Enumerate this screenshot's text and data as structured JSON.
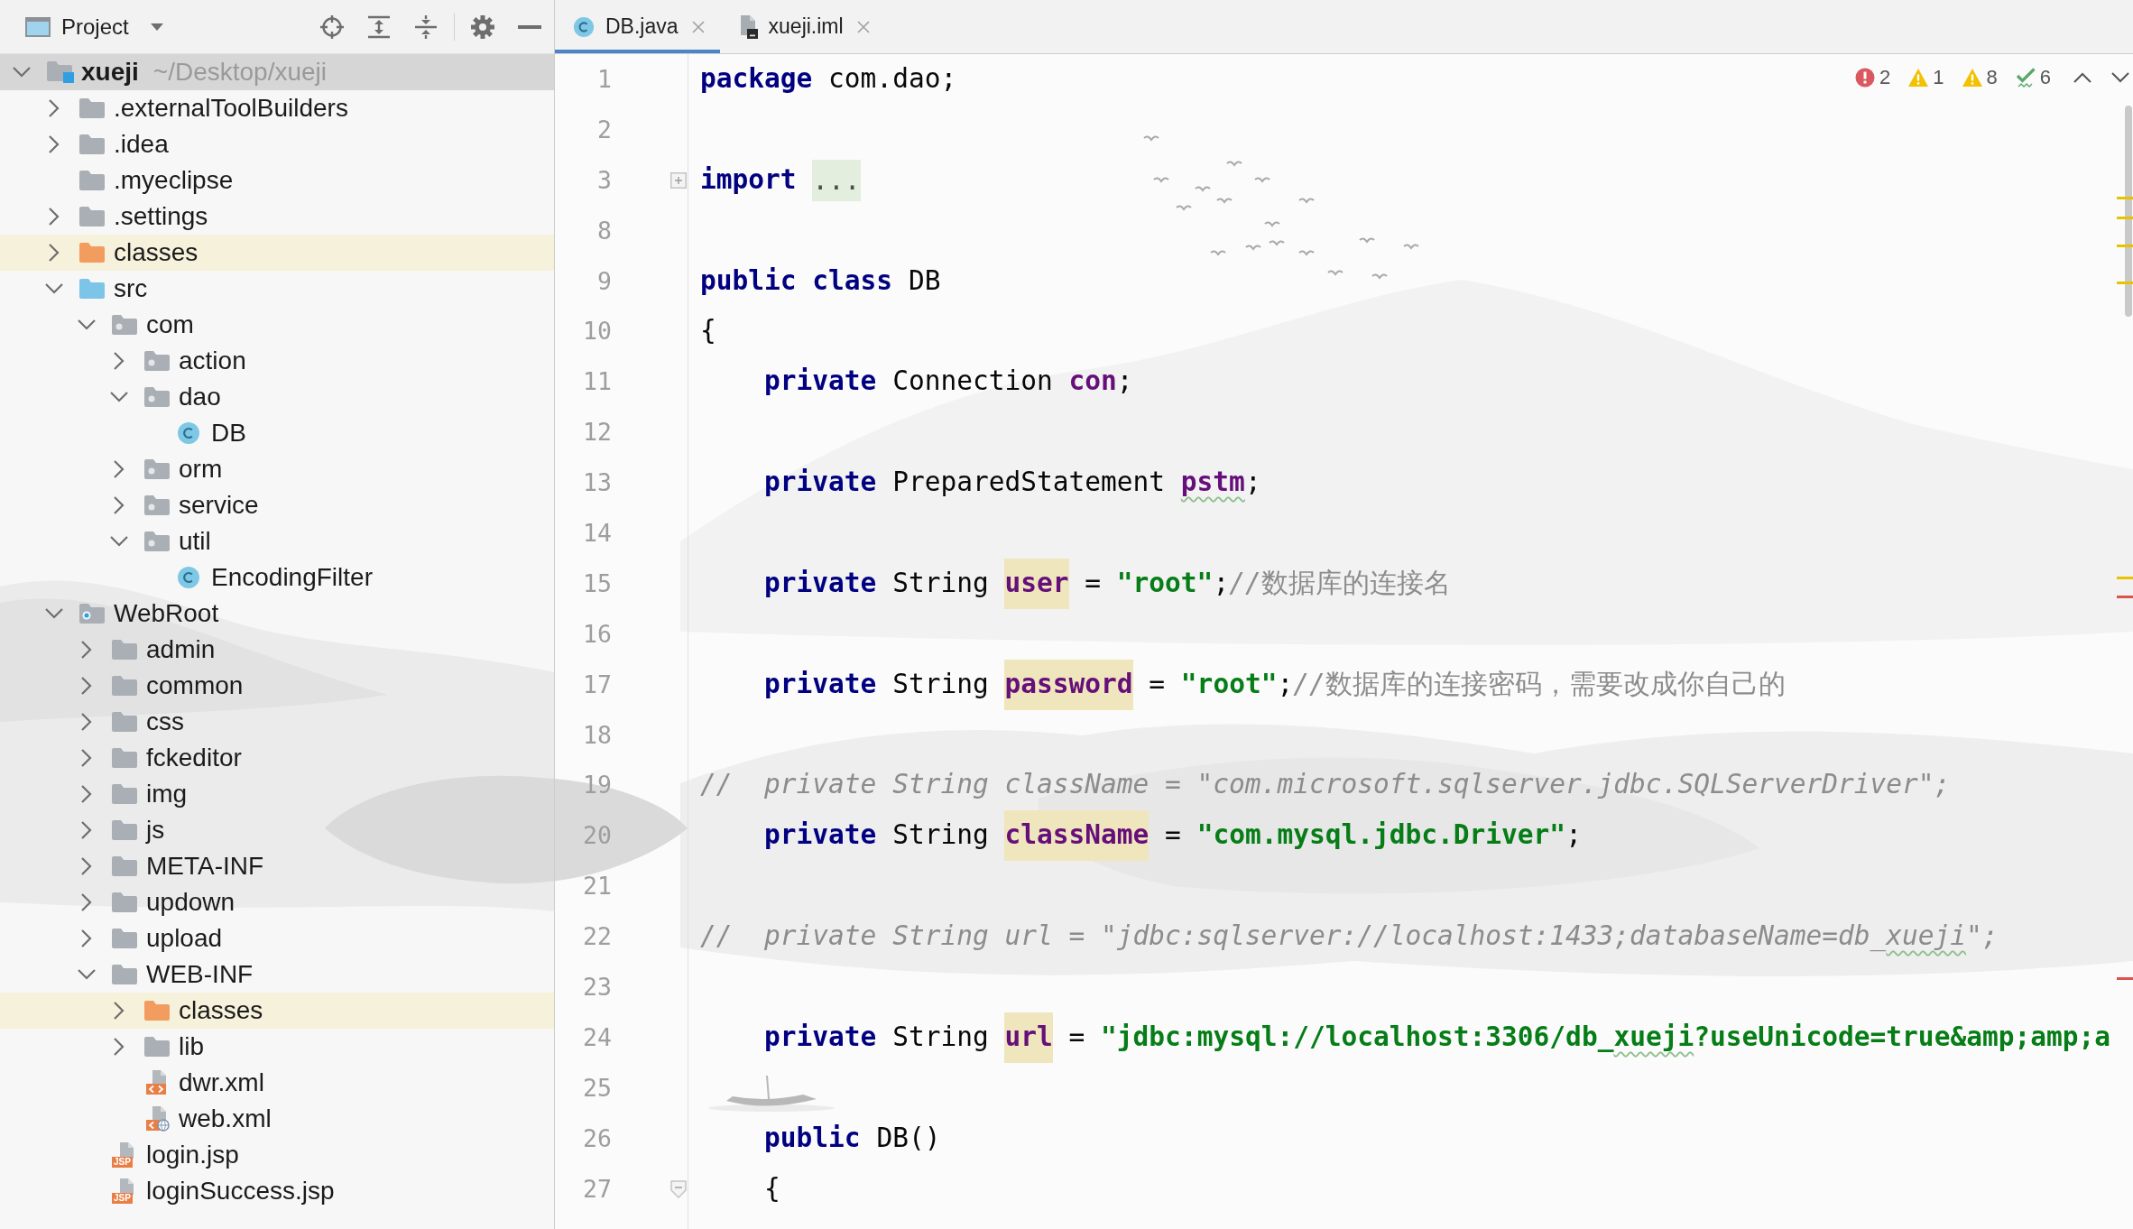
{
  "project_panel": {
    "title": "Project",
    "tree": [
      {
        "name": "xueji",
        "path": "~/Desktop/xueji",
        "kind": "module",
        "selected": true,
        "highlighted": false,
        "expanded": true,
        "children": [
          {
            "name": ".externalToolBuilders",
            "kind": "folder",
            "selected": false,
            "highlighted": false,
            "expanded": false
          },
          {
            "name": ".idea",
            "kind": "folder",
            "selected": false,
            "highlighted": false,
            "expanded": false
          },
          {
            "name": ".myeclipse",
            "kind": "folder",
            "selected": false,
            "highlighted": false
          },
          {
            "name": ".settings",
            "kind": "folder",
            "selected": false,
            "highlighted": false,
            "expanded": false
          },
          {
            "name": "classes",
            "kind": "excluded_folder",
            "selected": false,
            "highlighted": true,
            "expanded": false
          },
          {
            "name": "src",
            "kind": "source_folder",
            "selected": false,
            "highlighted": false,
            "expanded": true,
            "children": [
              {
                "name": "com",
                "kind": "package",
                "selected": false,
                "highlighted": false,
                "expanded": true,
                "children": [
                  {
                    "name": "action",
                    "kind": "package",
                    "selected": false,
                    "highlighted": false,
                    "expanded": false
                  },
                  {
                    "name": "dao",
                    "kind": "package",
                    "selected": false,
                    "highlighted": false,
                    "expanded": true,
                    "children": [
                      {
                        "name": "DB",
                        "kind": "class",
                        "selected": false,
                        "highlighted": false
                      }
                    ]
                  },
                  {
                    "name": "orm",
                    "kind": "package",
                    "selected": false,
                    "highlighted": false,
                    "expanded": false
                  },
                  {
                    "name": "service",
                    "kind": "package",
                    "selected": false,
                    "highlighted": false,
                    "expanded": false
                  },
                  {
                    "name": "util",
                    "kind": "package",
                    "selected": false,
                    "highlighted": false,
                    "expanded": true,
                    "children": [
                      {
                        "name": "EncodingFilter",
                        "kind": "class",
                        "selected": false,
                        "highlighted": false
                      }
                    ]
                  }
                ]
              }
            ]
          },
          {
            "name": "WebRoot",
            "kind": "web_folder",
            "selected": false,
            "highlighted": false,
            "expanded": true,
            "children": [
              {
                "name": "admin",
                "kind": "folder",
                "selected": false,
                "highlighted": false,
                "expanded": false
              },
              {
                "name": "common",
                "kind": "folder",
                "selected": false,
                "highlighted": false,
                "expanded": false
              },
              {
                "name": "css",
                "kind": "folder",
                "selected": false,
                "highlighted": false,
                "expanded": false
              },
              {
                "name": "fckeditor",
                "kind": "folder",
                "selected": false,
                "highlighted": false,
                "expanded": false
              },
              {
                "name": "img",
                "kind": "folder",
                "selected": false,
                "highlighted": false,
                "expanded": false
              },
              {
                "name": "js",
                "kind": "folder",
                "selected": false,
                "highlighted": false,
                "expanded": false
              },
              {
                "name": "META-INF",
                "kind": "folder",
                "selected": false,
                "highlighted": false,
                "expanded": false
              },
              {
                "name": "updown",
                "kind": "folder",
                "selected": false,
                "highlighted": false,
                "expanded": false
              },
              {
                "name": "upload",
                "kind": "folder",
                "selected": false,
                "highlighted": false,
                "expanded": false
              },
              {
                "name": "WEB-INF",
                "kind": "folder",
                "selected": false,
                "highlighted": false,
                "expanded": true,
                "children": [
                  {
                    "name": "classes",
                    "kind": "excluded_folder",
                    "selected": false,
                    "highlighted": true,
                    "expanded": false
                  },
                  {
                    "name": "lib",
                    "kind": "folder",
                    "selected": false,
                    "highlighted": false,
                    "expanded": false
                  },
                  {
                    "name": "dwr.xml",
                    "kind": "xml_file",
                    "selected": false,
                    "highlighted": false
                  },
                  {
                    "name": "web.xml",
                    "kind": "web_xml_file",
                    "selected": false,
                    "highlighted": false
                  }
                ]
              },
              {
                "name": "login.jsp",
                "kind": "jsp_file",
                "icon_label": "JSP",
                "selected": false,
                "highlighted": false
              },
              {
                "name": "loginSuccess.jsp",
                "kind": "jsp_file",
                "icon_label": "JSP",
                "selected": false,
                "highlighted": false
              }
            ]
          }
        ]
      }
    ]
  },
  "editor": {
    "tabs": [
      {
        "label": "DB.java",
        "kind": "class",
        "selected": true
      },
      {
        "label": "xueji.iml",
        "kind": "module_file",
        "selected": false
      }
    ],
    "inspections": [
      {
        "kind": "error",
        "count": "2"
      },
      {
        "kind": "warning",
        "count": "1"
      },
      {
        "kind": "weak_warning",
        "count": "8"
      },
      {
        "kind": "typo",
        "count": "6"
      }
    ],
    "error_stripe": [
      {
        "kind": "warning"
      },
      {
        "kind": "warning"
      },
      {
        "kind": "warning"
      },
      {
        "kind": "warning"
      },
      {
        "kind": "warning"
      },
      {
        "kind": "error"
      },
      {
        "kind": "error"
      }
    ],
    "lines": [
      {
        "number": "1",
        "tokens": [
          {
            "kind": "keyword",
            "text": "package",
            "highlighted": false,
            "typo": false
          },
          {
            "kind": "plain",
            "text": " com.dao;",
            "highlighted": false,
            "typo": false
          }
        ]
      },
      {
        "number": "2"
      },
      {
        "number": "3",
        "fold": {
          "kind": "collapsed"
        },
        "tokens": [
          {
            "kind": "keyword",
            "text": "import ",
            "highlighted": false,
            "typo": false
          },
          {
            "kind": "folded",
            "text": "...",
            "highlighted": false,
            "typo": false
          }
        ]
      },
      {
        "number": "8"
      },
      {
        "number": "9",
        "tokens": [
          {
            "kind": "keyword",
            "text": "public class",
            "highlighted": false,
            "typo": false
          },
          {
            "kind": "plain",
            "text": " DB",
            "highlighted": false,
            "typo": false
          }
        ]
      },
      {
        "number": "10",
        "tokens": [
          {
            "kind": "plain",
            "text": "{",
            "highlighted": false,
            "typo": false
          }
        ]
      },
      {
        "number": "11",
        "tokens": [
          {
            "kind": "keyword",
            "text": "    private",
            "highlighted": false,
            "typo": false
          },
          {
            "kind": "plain",
            "text": " Connection ",
            "highlighted": false,
            "typo": false
          },
          {
            "kind": "field",
            "text": "con",
            "highlighted": false,
            "typo": false
          },
          {
            "kind": "plain",
            "text": ";",
            "highlighted": false,
            "typo": false
          }
        ]
      },
      {
        "number": "12"
      },
      {
        "number": "13",
        "tokens": [
          {
            "kind": "keyword",
            "text": "    private",
            "highlighted": false,
            "typo": false
          },
          {
            "kind": "plain",
            "text": " PreparedStatement ",
            "highlighted": false,
            "typo": false
          },
          {
            "kind": "field",
            "text": "pstm",
            "highlighted": false,
            "typo": true
          },
          {
            "kind": "plain",
            "text": ";",
            "highlighted": false,
            "typo": false
          }
        ]
      },
      {
        "number": "14"
      },
      {
        "number": "15",
        "tokens": [
          {
            "kind": "keyword",
            "text": "    private",
            "highlighted": false,
            "typo": false
          },
          {
            "kind": "plain",
            "text": " String ",
            "highlighted": false,
            "typo": false
          },
          {
            "kind": "field",
            "text": "user",
            "highlighted": true,
            "typo": false
          },
          {
            "kind": "plain",
            "text": " = ",
            "highlighted": false,
            "typo": false
          },
          {
            "kind": "string",
            "text": "\"root\"",
            "highlighted": false,
            "typo": false
          },
          {
            "kind": "plain",
            "text": ";",
            "highlighted": false,
            "typo": false
          },
          {
            "kind": "comment",
            "text": "//数据库的连接名",
            "highlighted": false,
            "typo": false
          }
        ]
      },
      {
        "number": "16"
      },
      {
        "number": "17",
        "tokens": [
          {
            "kind": "keyword",
            "text": "    private",
            "highlighted": false,
            "typo": false
          },
          {
            "kind": "plain",
            "text": " String ",
            "highlighted": false,
            "typo": false
          },
          {
            "kind": "field",
            "text": "password",
            "highlighted": true,
            "typo": false
          },
          {
            "kind": "plain",
            "text": " = ",
            "highlighted": false,
            "typo": false
          },
          {
            "kind": "string",
            "text": "\"root\"",
            "highlighted": false,
            "typo": false
          },
          {
            "kind": "plain",
            "text": ";",
            "highlighted": false,
            "typo": false
          },
          {
            "kind": "comment",
            "text": "//数据库的连接密码，需要改成你自己的",
            "highlighted": false,
            "typo": false
          }
        ]
      },
      {
        "number": "18"
      },
      {
        "number": "19",
        "tokens": [
          {
            "kind": "comment",
            "text": "//  private String className = \"com.microsoft.sqlserver.jdbc.SQLServerDriver\";",
            "highlighted": false,
            "typo": false
          }
        ]
      },
      {
        "number": "20",
        "tokens": [
          {
            "kind": "keyword",
            "text": "    private",
            "highlighted": false,
            "typo": false
          },
          {
            "kind": "plain",
            "text": " String ",
            "highlighted": false,
            "typo": false
          },
          {
            "kind": "field",
            "text": "className",
            "highlighted": true,
            "typo": false
          },
          {
            "kind": "plain",
            "text": " = ",
            "highlighted": false,
            "typo": false
          },
          {
            "kind": "string",
            "text": "\"com.mysql.jdbc.Driver\"",
            "highlighted": false,
            "typo": false
          },
          {
            "kind": "plain",
            "text": ";",
            "highlighted": false,
            "typo": false
          }
        ]
      },
      {
        "number": "21"
      },
      {
        "number": "22",
        "tokens": [
          {
            "kind": "comment",
            "text": "//  private String url = \"jdbc:sqlserver://localhost:1433;databaseName=db_",
            "highlighted": false,
            "typo": false
          },
          {
            "kind": "comment",
            "text": "xueji",
            "highlighted": false,
            "typo": true
          },
          {
            "kind": "comment",
            "text": "\";",
            "highlighted": false,
            "typo": false
          }
        ]
      },
      {
        "number": "23"
      },
      {
        "number": "24",
        "tokens": [
          {
            "kind": "keyword",
            "text": "    private",
            "highlighted": false,
            "typo": false
          },
          {
            "kind": "plain",
            "text": " String ",
            "highlighted": false,
            "typo": false
          },
          {
            "kind": "field",
            "text": "url",
            "highlighted": true,
            "typo": false
          },
          {
            "kind": "plain",
            "text": " = ",
            "highlighted": false,
            "typo": false
          },
          {
            "kind": "string",
            "text": "\"jdbc:mysql://localhost:3306/db_",
            "highlighted": false,
            "typo": false
          },
          {
            "kind": "string",
            "text": "xueji",
            "highlighted": false,
            "typo": true
          },
          {
            "kind": "string",
            "text": "?useUnicode=true&amp;amp;a",
            "highlighted": false,
            "typo": false
          }
        ]
      },
      {
        "number": "25"
      },
      {
        "number": "26",
        "tokens": [
          {
            "kind": "keyword",
            "text": "    public",
            "highlighted": false,
            "typo": false
          },
          {
            "kind": "plain",
            "text": " DB()",
            "highlighted": false,
            "typo": false
          }
        ]
      },
      {
        "number": "27",
        "fold": {
          "kind": "end"
        },
        "tokens": [
          {
            "kind": "plain",
            "text": "    {",
            "highlighted": false,
            "typo": false
          }
        ]
      }
    ]
  }
}
